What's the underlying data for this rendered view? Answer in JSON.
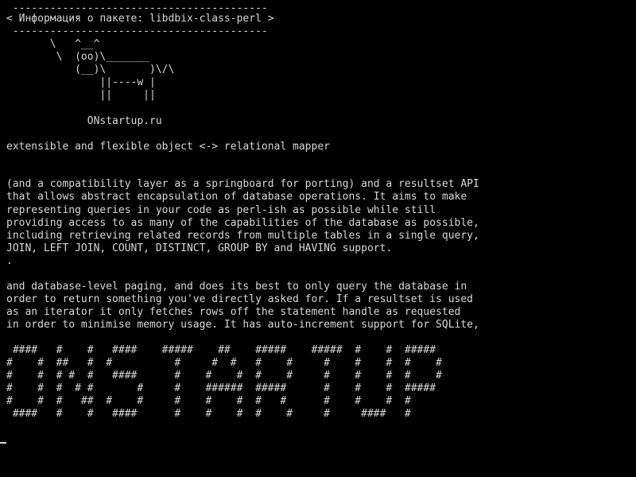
{
  "terminal": {
    "cowsay": {
      "border_top": " -----------------------------------------",
      "title": "< Информация о пакете: libdbix-class-perl >",
      "border_bottom": " -----------------------------------------",
      "cow": [
        "       \\   ^__^",
        "        \\  (oo)\\_______",
        "           (__)\\       )\\/\\",
        "               ||----w |",
        "               ||     ||"
      ],
      "site": "             ONstartup.ru"
    },
    "summary": "extensible and flexible object <-> relational mapper",
    "paragraph1": [
      "(and a compatibility layer as a springboard for porting) and a resultset API",
      "that allows abstract encapsulation of database operations. It aims to make",
      "representing queries in your code as perl-ish as possible while still",
      "providing access to as many of the capabilities of the database as possible,",
      "including retrieving related records from multiple tables in a single query,",
      "JOIN, LEFT JOIN, COUNT, DISTINCT, GROUP BY and HAVING support.",
      "."
    ],
    "paragraph2": [
      "and database-level paging, and does its best to only query the database in",
      "order to return something you've directly asked for. If a resultset is used",
      "as an iterator it only fetches rows off the statement handle as requested",
      "in order to minimise memory usage. It has auto-increment support for SQLite,"
    ],
    "banner": [
      " ####   #    #   ####    #####    ##    #####    #####  #    #  #####",
      "#    #  ##   #  #          #     #  #   #    #     #    #    #  #    #",
      "#    #  # #  #   ####      #    #    #  #    #     #    #    #  #    #",
      "#    #  #  # #       #     #    ######  #####      #    #    #  #####",
      "#    #  #   ##  #    #     #    #    #  #   #      #    #    #  #",
      " ####   #    #   ####      #    #    #  #    #     #     ####   #"
    ]
  }
}
